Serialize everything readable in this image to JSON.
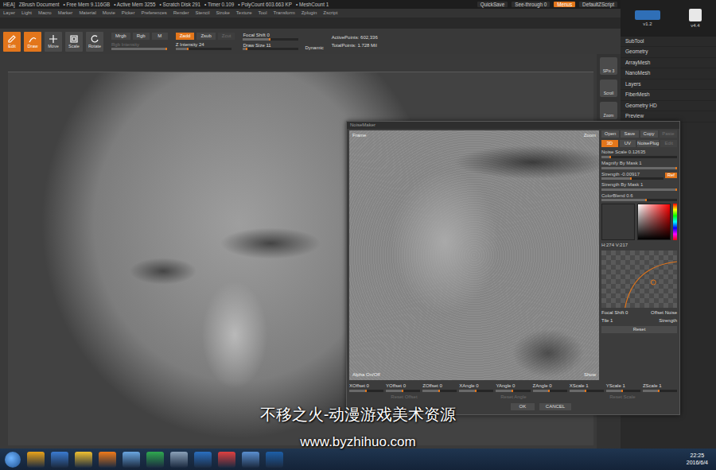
{
  "title_bar": {
    "texts": [
      "HEA]",
      "ZBrush Document",
      "• Free Mem 9.116GB",
      "• Active Mem 3255",
      "• Scratch Disk 291",
      "• Timer 0.109",
      "• PolyCount 603.663 KP",
      "• MeshCount 1"
    ],
    "buttons": [
      {
        "label": "QuickSave",
        "selected": false
      },
      {
        "label": "See-through 0",
        "selected": false
      },
      {
        "label": "Menus",
        "selected": true
      },
      {
        "label": "DefaultZScript",
        "selected": false
      }
    ]
  },
  "menu_bar": [
    "Layer",
    "Light",
    "Macro",
    "Marker",
    "Material",
    "Movie",
    "Picker",
    "Preferences",
    "Render",
    "Stencil",
    "Stroke",
    "Texture",
    "Tool",
    "Transform",
    "Zplugin",
    "Zscript"
  ],
  "toolbar": {
    "modes": [
      {
        "label": "Edit",
        "selected": true
      },
      {
        "label": "Draw",
        "selected": true
      },
      {
        "label": "Move",
        "selected": false
      },
      {
        "label": "Scale",
        "selected": false
      },
      {
        "label": "Rotate",
        "selected": false
      }
    ],
    "channels": [
      {
        "label": "Mrgb",
        "selected": false,
        "disabled": false
      },
      {
        "label": "Rgb",
        "selected": false,
        "disabled": false
      },
      {
        "label": "M",
        "selected": false,
        "disabled": false
      },
      {
        "label": "Zadd",
        "selected": true,
        "disabled": false
      },
      {
        "label": "Zsub",
        "selected": false,
        "disabled": false
      },
      {
        "label": "Zcut",
        "selected": false,
        "disabled": true
      }
    ],
    "sliders": [
      {
        "label": "Rgb Intensity",
        "level": 1,
        "disabled": true
      },
      {
        "label": "Z Intensity 24",
        "level": 0.24,
        "disabled": false
      },
      {
        "label": "Focal Shift 0",
        "level": 0.5,
        "disabled": false
      },
      {
        "label": "Draw Size 11",
        "level": 0.08,
        "disabled": false
      }
    ],
    "dynamic": "Dynamic",
    "stats": [
      "ActivePoints: 602,336",
      "TotalPoints: 1.728 Mil"
    ]
  },
  "shelf": [
    "SPix 3",
    "Scroll",
    "Zoom"
  ],
  "right_panel": {
    "logo": "v1.2",
    "user": "v4.4",
    "items": [
      "SubTool",
      "Geometry",
      "ArrayMesh",
      "NanoMesh",
      "Layers",
      "FiberMesh",
      "Geometry HD",
      "Preview"
    ]
  },
  "noisemaker": {
    "title": "NoiseMaker",
    "preview": {
      "frame": "Frame",
      "zoom": "Zoom",
      "alpha": "Alpha On/Off",
      "show": "Show"
    },
    "file_buttons": [
      {
        "label": "Open",
        "disabled": false
      },
      {
        "label": "Save",
        "disabled": false
      },
      {
        "label": "Copy",
        "disabled": false
      },
      {
        "label": "Paste",
        "disabled": true
      }
    ],
    "mode_tabs": [
      {
        "label": "3D",
        "selected": true,
        "disabled": false
      },
      {
        "label": "UV",
        "selected": false,
        "disabled": false
      },
      {
        "label": "NoisePlug",
        "selected": false,
        "disabled": false
      },
      {
        "label": "Edit",
        "selected": false,
        "disabled": true
      }
    ],
    "controls": [
      {
        "kind": "slider",
        "label": "Noise Scale 0.12635",
        "level": 0.13
      },
      {
        "kind": "slider",
        "label": "Magnify By Mask 1",
        "level": 1
      },
      {
        "kind": "button",
        "label": "Strength -0.00917",
        "button": "Ref",
        "level": 0.49
      },
      {
        "kind": "slider",
        "label": "Strength By Mask 1",
        "level": 1
      },
      {
        "kind": "slider",
        "label": "ColorBlend 0.6",
        "level": 0.6
      }
    ],
    "color_reading": "H:274 V:217",
    "curve_rows": [
      {
        "left": "Focal Shift 0",
        "right": "Offset Noise"
      },
      {
        "left": "Tile 1",
        "right": "Strength"
      }
    ],
    "curve_buttons": [
      "Reset"
    ],
    "axes": [
      {
        "label": "XOffset 0",
        "level": 0.5
      },
      {
        "label": "YOffset 0",
        "level": 0.5
      },
      {
        "label": "ZOffset 0",
        "level": 0.5
      },
      {
        "label": "XAngle 0",
        "level": 0.5
      },
      {
        "label": "YAngle 0",
        "level": 0.5
      },
      {
        "label": "ZAngle 0",
        "level": 0.5
      },
      {
        "label": "XScale 1",
        "level": 0.5
      },
      {
        "label": "YScale 1",
        "level": 0.5
      },
      {
        "label": "ZScale 1",
        "level": 0.5
      }
    ],
    "resets": [
      {
        "label": "Reset Offset",
        "disabled": true
      },
      {
        "label": "Reset Angle",
        "disabled": true
      },
      {
        "label": "Reset Scale",
        "disabled": true
      }
    ],
    "actions": [
      "OK",
      "CANCEL"
    ]
  },
  "watermark": {
    "line1": "不移之火-动漫游戏美术资源",
    "line2": "www.byzhihuo.com"
  },
  "taskbar": {
    "time": "22:25",
    "date": "2016/6/4"
  }
}
